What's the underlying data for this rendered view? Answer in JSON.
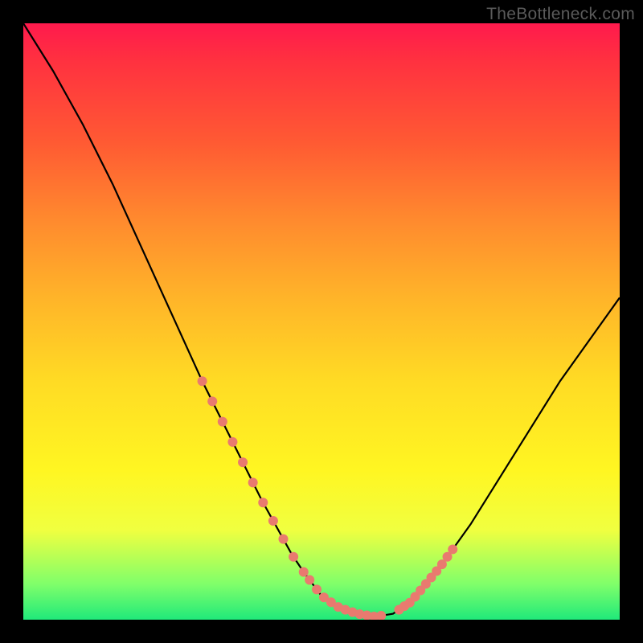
{
  "watermark": "TheBottleneck.com",
  "chart_data": {
    "type": "line",
    "title": "",
    "xlabel": "",
    "ylabel": "",
    "xlim": [
      0,
      100
    ],
    "ylim": [
      0,
      100
    ],
    "notes": "Rainbow vertical gradient background (red top → green bottom). Single V-shaped black curve with salmon dotted segments near the trough.",
    "series": [
      {
        "name": "curve",
        "color": "#000000",
        "x": [
          0,
          5,
          10,
          15,
          20,
          25,
          30,
          35,
          40,
          45,
          47,
          50,
          53,
          56,
          59,
          62,
          65,
          70,
          75,
          80,
          85,
          90,
          95,
          100
        ],
        "y": [
          100,
          92,
          83,
          73,
          62,
          51,
          40,
          30,
          20,
          11,
          8,
          4,
          2,
          1,
          0.5,
          1,
          3,
          9,
          16,
          24,
          32,
          40,
          47,
          54
        ]
      }
    ],
    "marker_ranges": [
      {
        "x_start": 30,
        "x_end": 47,
        "style": "salmon-dots"
      },
      {
        "x_start": 48,
        "x_end": 60,
        "style": "salmon-dots"
      },
      {
        "x_start": 63,
        "x_end": 72,
        "style": "salmon-dots"
      }
    ]
  }
}
